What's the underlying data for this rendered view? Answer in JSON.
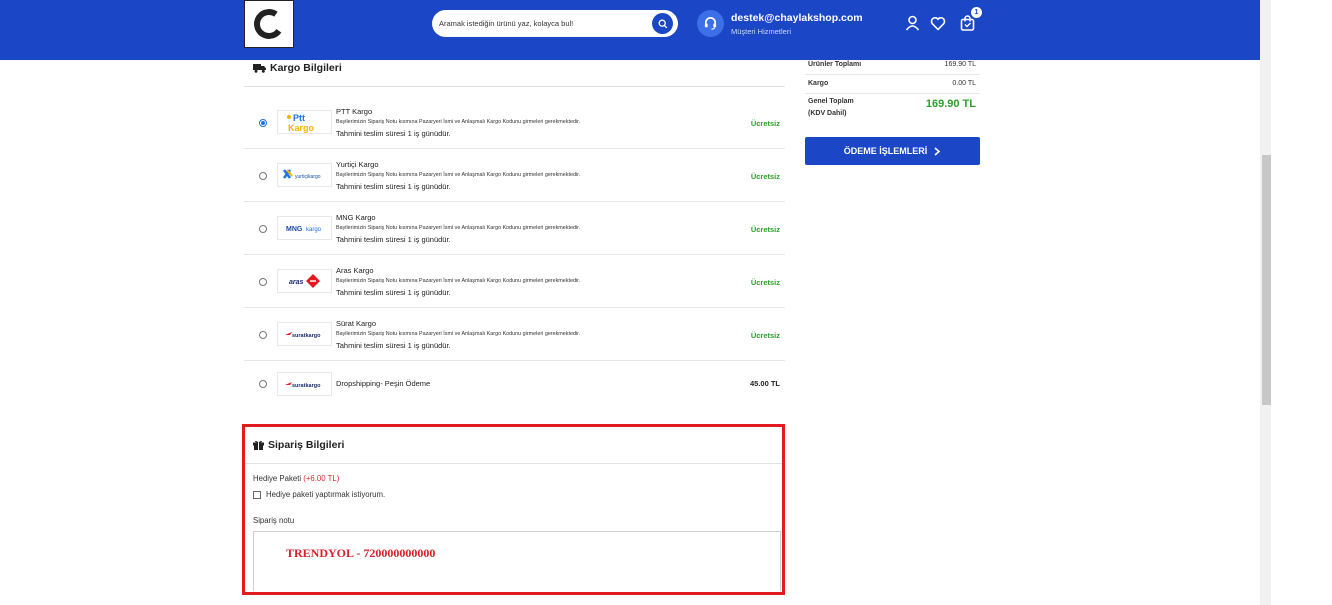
{
  "header": {
    "search_placeholder": "Aramak istediğin ürünü yaz, kolayca bul!",
    "support_email": "destek@chaylakshop.com",
    "support_label": "Müşteri Hizmetleri",
    "cart_count": "1",
    "brand_color": "#1b47c7"
  },
  "cargo": {
    "title": "Kargo Bilgileri",
    "items": [
      {
        "name": "PTT Kargo",
        "note": "Bayilerimizin Sipariş Notu kısmına Pazaryeri İsmi ve Anlaşmalı Kargo Kodunu girmeleri gerekmektedir.",
        "eta": "Tahmini teslim süresi 1 iş günüdür.",
        "price": "Ücretsiz",
        "selected": true,
        "logo": "ptt-kargo-logo"
      },
      {
        "name": "Yurtiçi Kargo",
        "note": "Bayilerimizin Sipariş Notu kısmına Pazaryeri İsmi ve Anlaşmalı Kargo Kodunu girmeleri gerekmektedir.",
        "eta": "Tahmini teslim süresi 1 iş günüdür.",
        "price": "Ücretsiz",
        "selected": false,
        "logo": "yurtici-kargo-logo"
      },
      {
        "name": "MNG Kargo",
        "note": "Bayilerimizin Sipariş Notu kısmına Pazaryeri İsmi ve Anlaşmalı Kargo Kodunu girmeleri gerekmektedir.",
        "eta": "Tahmini teslim süresi 1 iş günüdür.",
        "price": "Ücretsiz",
        "selected": false,
        "logo": "mng-kargo-logo"
      },
      {
        "name": "Aras Kargo",
        "note": "Bayilerimizin Sipariş Notu kısmına Pazaryeri İsmi ve Anlaşmalı Kargo Kodunu girmeleri gerekmektedir.",
        "eta": "Tahmini teslim süresi 1 iş günüdür.",
        "price": "Ücretsiz",
        "selected": false,
        "logo": "aras-kargo-logo"
      },
      {
        "name": "Sürat Kargo",
        "note": "Bayilerimizin Sipariş Notu kısmına Pazaryeri İsmi ve Anlaşmalı Kargo Kodunu girmeleri gerekmektedir.",
        "eta": "Tahmini teslim süresi 1 iş günüdür.",
        "price": "Ücretsiz",
        "selected": false,
        "logo": "surat-kargo-logo"
      },
      {
        "name": "Dropshipping- Peşin Ödeme",
        "price": "45.00 TL",
        "selected": false,
        "logo": "surat-kargo-logo"
      }
    ]
  },
  "summary": {
    "products_total_label": "Ürünler Toplamı",
    "products_total_value": "169.90 TL",
    "cargo_label": "Kargo",
    "cargo_value": "0.00 TL",
    "grand_total_label": "Genel Toplam",
    "grand_total_sub": "(KDV Dahil)",
    "grand_total_value": "169.90 TL",
    "pay_button": "ÖDEME İŞLEMLERİ"
  },
  "order": {
    "title": "Sipariş Bilgileri",
    "gift_label": "Hediye Paketi",
    "gift_price": "(+6.00 TL)",
    "gift_checkbox_label": "Hediye paketi yaptırmak istiyorum.",
    "note_label": "Sipariş notu",
    "note_value": "TRENDYOL - 720000000000"
  },
  "logos": {
    "ptt": "Ptt",
    "ptt_sub": "Kargo",
    "yurtici": "yurtiçikargo",
    "mng_main": "MNG",
    "mng_sub": "kargo",
    "aras": "aras",
    "surat": "suratkargo"
  }
}
